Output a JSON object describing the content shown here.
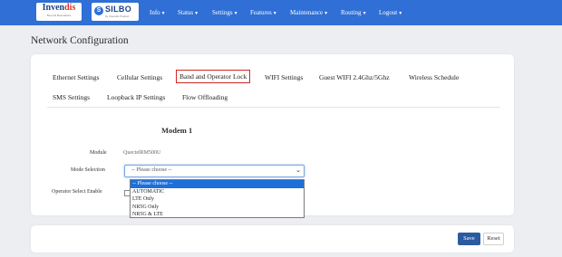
{
  "navbar": {
    "logo_invendis_main": "Invendis",
    "logo_invendis_tagline": "Beyond Boundaries",
    "logo_silbo": "SILBO",
    "logo_silbo_tagline": "by Invendis Product",
    "menu": [
      "Info",
      "Status",
      "Settings",
      "Features",
      "Maintenance",
      "Routing",
      "Logout"
    ]
  },
  "page": {
    "title": "Network Configuration"
  },
  "tabs": [
    {
      "label": "Ethernet Settings",
      "active": false
    },
    {
      "label": "Cellular Settings",
      "active": false
    },
    {
      "label": "Band and Operator Lock",
      "active": true
    },
    {
      "label": "WIFI Settings",
      "active": false
    },
    {
      "label": "Guest WIFI 2.4Ghz/5Ghz",
      "active": false
    },
    {
      "label": "Wireless Schedule",
      "active": false
    },
    {
      "label": "SMS Settings",
      "active": false
    },
    {
      "label": "Loopback IP Settings",
      "active": false
    },
    {
      "label": "Flow Offloading",
      "active": false
    }
  ],
  "modem": {
    "title": "Modem 1",
    "module_label": "Module",
    "module_value": "QuectelRM500U",
    "mode_label": "Mode Selection",
    "mode_value": "-- Please choose --",
    "operator_label": "Operator Select Enable",
    "mode_options": [
      "-- Please choose --",
      "AUTOMATIC",
      "LTE Only",
      "NR5G Only",
      "NR5G & LTE"
    ],
    "selected_option_index": 0
  },
  "buttons": {
    "save": "Save",
    "reset": "Reset"
  },
  "colors": {
    "navbar": "#2f6fd6",
    "active_tab_border": "#d32424",
    "save_button": "#2c5aa0",
    "selected_option": "#1e6fd9"
  }
}
